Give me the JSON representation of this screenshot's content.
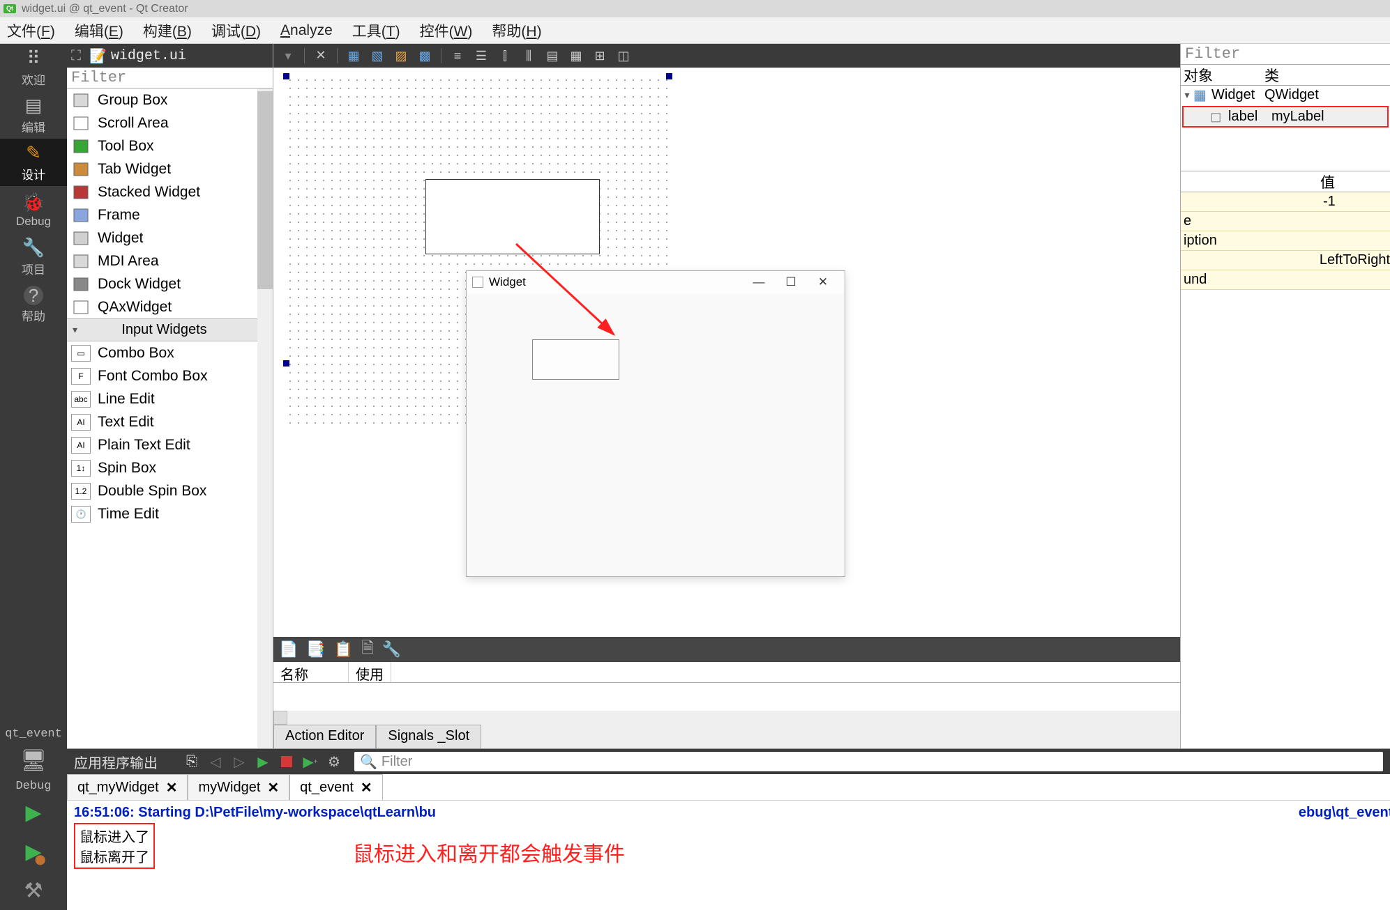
{
  "window_title": "widget.ui @ qt_event - Qt Creator",
  "menubar": [
    "文件(F)",
    "编辑(E)",
    "构建(B)",
    "调试(D)",
    "Analyze",
    "工具(T)",
    "控件(W)",
    "帮助(H)"
  ],
  "leftnav": [
    {
      "icon": "⠿",
      "label": "欢迎"
    },
    {
      "icon": "≡",
      "label": "编辑"
    },
    {
      "icon": "✎",
      "label": "设计",
      "selected": true
    },
    {
      "icon": "🐞",
      "label": "Debug"
    },
    {
      "icon": "🔧",
      "label": "项目"
    },
    {
      "icon": "?",
      "label": "帮助"
    }
  ],
  "leftnav_bottom": {
    "project": "qt_event",
    "mode": "Debug"
  },
  "open_file": "widget.ui",
  "filter_placeholder": "Filter",
  "widget_items": [
    {
      "label": "Group Box",
      "ico": "#d8d8d8"
    },
    {
      "label": "Scroll Area",
      "ico": "#ffffff"
    },
    {
      "label": "Tool Box",
      "ico": "#37a637"
    },
    {
      "label": "Tab Widget",
      "ico": "#cc8b3a"
    },
    {
      "label": "Stacked Widget",
      "ico": "#b83838"
    },
    {
      "label": "Frame",
      "ico": "#8aa6e0"
    },
    {
      "label": "Widget",
      "ico": "#d0d0d0"
    },
    {
      "label": "MDI Area",
      "ico": "#d8d8d8"
    },
    {
      "label": "Dock Widget",
      "ico": "#888888"
    },
    {
      "label": "QAxWidget",
      "ico": "#ffffff"
    }
  ],
  "widget_section": "Input Widgets",
  "input_widgets": [
    {
      "label": "Combo Box"
    },
    {
      "label": "Font Combo Box"
    },
    {
      "label": "Line Edit"
    },
    {
      "label": "Text Edit"
    },
    {
      "label": "Plain Text Edit"
    },
    {
      "label": "Spin Box"
    },
    {
      "label": "Double Spin Box"
    },
    {
      "label": "Time Edit"
    }
  ],
  "object_inspector": {
    "filter": "Filter",
    "headers": [
      "对象",
      "类"
    ],
    "rows": [
      {
        "name": "Widget",
        "cls": "QWidget",
        "root": true
      },
      {
        "name": "label",
        "cls": "myLabel"
      }
    ]
  },
  "property_editor": {
    "headers": [
      "",
      "值"
    ],
    "rows": [
      {
        "name": "",
        "value": "-1"
      },
      {
        "name": "e",
        "value": ""
      },
      {
        "name": "iption",
        "value": ""
      },
      {
        "name": "",
        "value": "LeftToRight"
      },
      {
        "name": "und",
        "value": ""
      }
    ]
  },
  "action_editor": {
    "headers": [
      "名称",
      "使用"
    ],
    "tabs": [
      "Action Editor",
      "Signals _Slot"
    ]
  },
  "run_window": {
    "title": "Widget"
  },
  "output": {
    "title": "应用程序输出",
    "search_placeholder": "Filter",
    "tabs": [
      {
        "label": "qt_myWidget"
      },
      {
        "label": "myWidget"
      },
      {
        "label": "qt_event",
        "active": true
      }
    ],
    "start_line": "16:51:06: Starting D:\\PetFile\\my-workspace\\qtLearn\\bu",
    "start_line_tail": "ebug\\qt_event.",
    "log": [
      "鼠标进入了",
      "鼠标离开了"
    ],
    "annotation": "鼠标进入和离开都会触发事件"
  }
}
